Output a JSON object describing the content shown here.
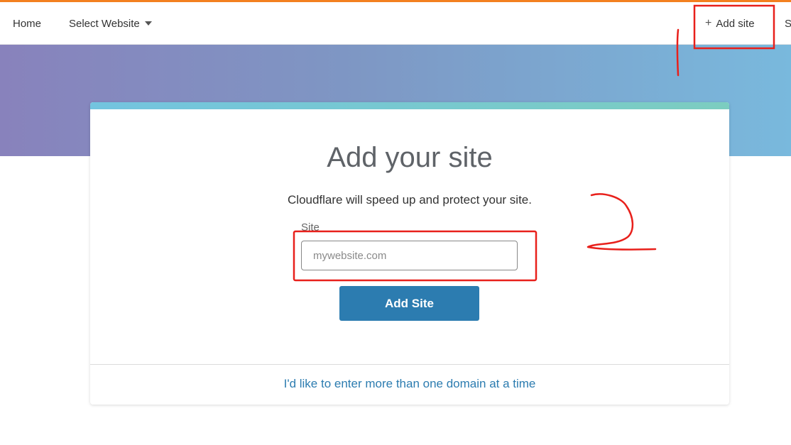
{
  "nav": {
    "home_label": "Home",
    "select_website_label": "Select Website",
    "add_site_label": "Add site",
    "truncated_item_label": "S"
  },
  "icons": {
    "plus": "+",
    "dropdown": "caret-down-icon"
  },
  "card": {
    "title": "Add your site",
    "subtitle": "Cloudflare will speed up and protect your site.",
    "site_label": "Site",
    "site_placeholder": "mywebsite.com",
    "site_value": "",
    "submit_label": "Add Site",
    "multi_domain_link": "I'd like to enter more than one domain at a time"
  },
  "colors": {
    "accent_top": "#f38020",
    "hero_gradient_start": "#8882bc",
    "hero_gradient_end": "#79b9dd",
    "primary_button": "#2c7cb0",
    "link": "#2c7cb0",
    "annotation": "#e8201b"
  }
}
